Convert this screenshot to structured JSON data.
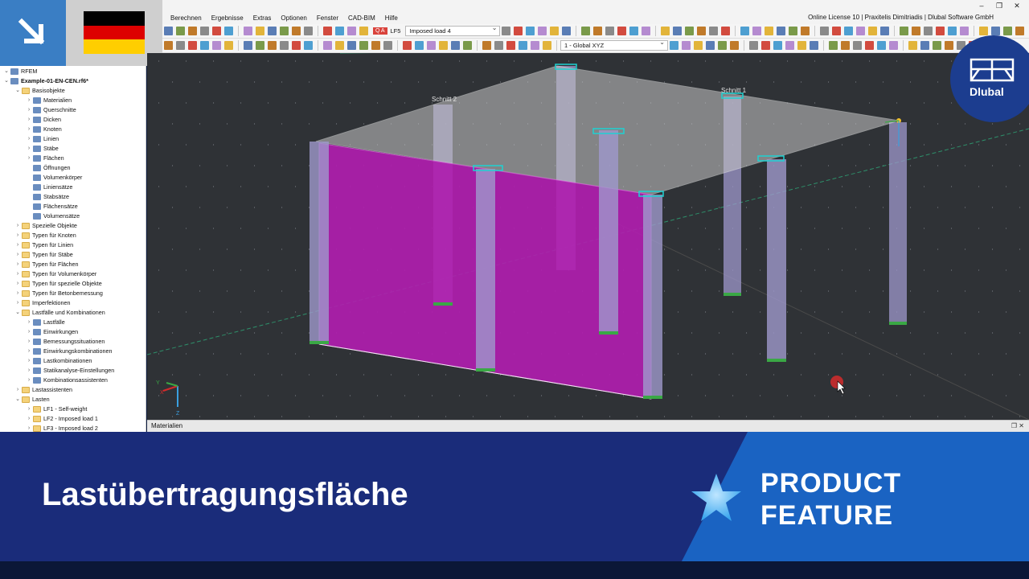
{
  "menu": {
    "items": [
      "Berechnen",
      "Ergebnisse",
      "Extras",
      "Optionen",
      "Fenster",
      "CAD-BIM",
      "Hilfe"
    ],
    "license": "Online License 10 | Praxitelis Dimitriadis | Dlubal Software GmbH",
    "window_buttons": [
      "–",
      "❐",
      "✕"
    ]
  },
  "toolbar": {
    "loadcase_tag": "Q A",
    "loadcase_code": "LF5",
    "loadcase_name": "Imposed load 4",
    "view_combo": "1 - Global XYZ"
  },
  "navigator": {
    "items": [
      {
        "level": 0,
        "label": "RFEM",
        "icon": "rfem-icon",
        "expanded": true,
        "bold": false
      },
      {
        "level": 0,
        "label": "Example-01-EN-CEN.rf6*",
        "icon": "model-icon",
        "expanded": true,
        "bold": true
      },
      {
        "level": 1,
        "label": "Basisobjekte",
        "icon": "folder-icon",
        "expanded": true
      },
      {
        "level": 2,
        "label": "Materialien",
        "icon": "materials-icon",
        "expanded": false
      },
      {
        "level": 2,
        "label": "Querschnitte",
        "icon": "sections-icon",
        "expanded": false
      },
      {
        "level": 2,
        "label": "Dicken",
        "icon": "thickness-icon",
        "expanded": false
      },
      {
        "level": 2,
        "label": "Knoten",
        "icon": "node-icon",
        "expanded": false
      },
      {
        "level": 2,
        "label": "Linien",
        "icon": "line-icon",
        "expanded": false
      },
      {
        "level": 2,
        "label": "Stäbe",
        "icon": "member-icon",
        "expanded": false
      },
      {
        "level": 2,
        "label": "Flächen",
        "icon": "surface-icon",
        "expanded": false
      },
      {
        "level": 2,
        "label": "Öffnungen",
        "icon": "opening-icon",
        "expanded": null
      },
      {
        "level": 2,
        "label": "Volumenkörper",
        "icon": "solid-icon",
        "expanded": null
      },
      {
        "level": 2,
        "label": "Liniensätze",
        "icon": "lineset-icon",
        "expanded": null
      },
      {
        "level": 2,
        "label": "Stabsätze",
        "icon": "memberset-icon",
        "expanded": null
      },
      {
        "level": 2,
        "label": "Flächensätze",
        "icon": "surfaceset-icon",
        "expanded": null
      },
      {
        "level": 2,
        "label": "Volumensätze",
        "icon": "solidset-icon",
        "expanded": null
      },
      {
        "level": 1,
        "label": "Spezielle Objekte",
        "icon": "folder-icon",
        "expanded": false
      },
      {
        "level": 1,
        "label": "Typen für Knoten",
        "icon": "folder-icon",
        "expanded": false
      },
      {
        "level": 1,
        "label": "Typen für Linien",
        "icon": "folder-icon",
        "expanded": false
      },
      {
        "level": 1,
        "label": "Typen für Stäbe",
        "icon": "folder-icon",
        "expanded": false
      },
      {
        "level": 1,
        "label": "Typen für Flächen",
        "icon": "folder-icon",
        "expanded": false
      },
      {
        "level": 1,
        "label": "Typen für Volumenkörper",
        "icon": "folder-icon",
        "expanded": false
      },
      {
        "level": 1,
        "label": "Typen für spezielle Objekte",
        "icon": "folder-icon",
        "expanded": false
      },
      {
        "level": 1,
        "label": "Typen für Betonbemessung",
        "icon": "folder-icon",
        "expanded": false
      },
      {
        "level": 1,
        "label": "Imperfektionen",
        "icon": "folder-icon",
        "expanded": false
      },
      {
        "level": 1,
        "label": "Lastfälle und Kombinationen",
        "icon": "folder-icon",
        "expanded": true
      },
      {
        "level": 2,
        "label": "Lastfälle",
        "icon": "loadcase-icon",
        "expanded": false
      },
      {
        "level": 2,
        "label": "Einwirkungen",
        "icon": "action-icon",
        "expanded": false
      },
      {
        "level": 2,
        "label": "Bemessungssituationen",
        "icon": "design-situation-icon",
        "expanded": false
      },
      {
        "level": 2,
        "label": "Einwirkungskombinationen",
        "icon": "action-combo-icon",
        "expanded": false
      },
      {
        "level": 2,
        "label": "Lastkombinationen",
        "icon": "load-combo-icon",
        "expanded": false
      },
      {
        "level": 2,
        "label": "Statikanalyse-Einstellungen",
        "icon": "analysis-settings-icon",
        "expanded": false
      },
      {
        "level": 2,
        "label": "Kombinationsassistenten",
        "icon": "combo-wizard-icon",
        "expanded": false
      },
      {
        "level": 1,
        "label": "Lastassistenten",
        "icon": "folder-icon",
        "expanded": false
      },
      {
        "level": 1,
        "label": "Lasten",
        "icon": "folder-icon",
        "expanded": true
      },
      {
        "level": 2,
        "label": "LF1 - Self-weight",
        "icon": "folder-icon",
        "expanded": false
      },
      {
        "level": 2,
        "label": "LF2 - Imposed load 1",
        "icon": "folder-icon",
        "expanded": false
      },
      {
        "level": 2,
        "label": "LF3 - Imposed load 2",
        "icon": "folder-icon",
        "expanded": false
      }
    ]
  },
  "viewport": {
    "section_labels": [
      "Schnitt 2",
      "Schnitt 1"
    ],
    "axis_labels": {
      "x": "X",
      "y": "Y",
      "z": "Z"
    },
    "colors": {
      "background": "#2f3236",
      "wall": "#b21eb0",
      "column": "#9f98cc",
      "slab": "#c8c8c8",
      "support": "#1ed2d2"
    }
  },
  "panel": {
    "title": "Materialien",
    "controls": "❐  ✕"
  },
  "logo": {
    "text": "Dlubal"
  },
  "banner": {
    "title": "Lastübertragungsfläche",
    "tag_line1": "PRODUCT",
    "tag_line2": "FEATURE",
    "colors": {
      "left": "#1a2c7a",
      "right": "#1a63c2"
    }
  },
  "flag": {
    "colors": [
      "#000000",
      "#dd0000",
      "#ffce00"
    ]
  }
}
